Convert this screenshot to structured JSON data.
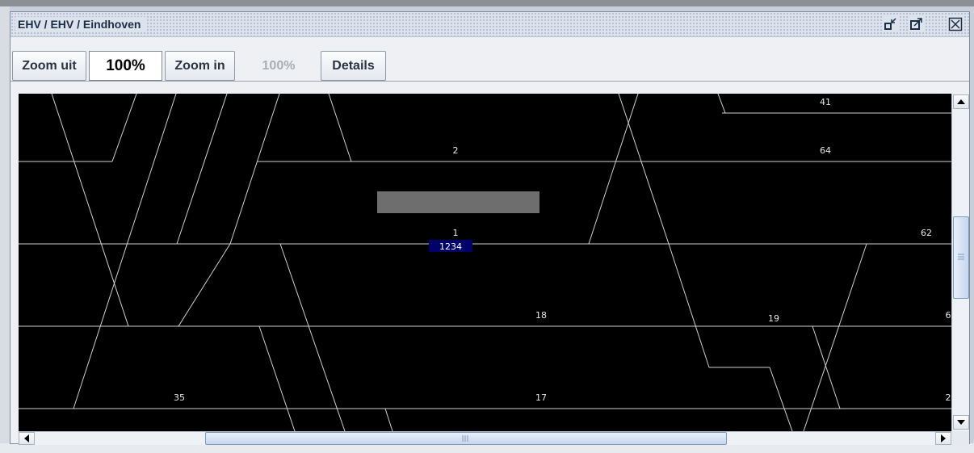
{
  "window": {
    "title": "EHV / EHV / Eindhoven",
    "buttons": {
      "minimize_icon": "iconify-icon",
      "maximize_icon": "maximize-icon",
      "close_icon": "close-icon"
    }
  },
  "toolbar": {
    "zoom_out_label": "Zoom uit",
    "zoom_value": "100%",
    "zoom_in_label": "Zoom in",
    "zoom_disabled_value": "100%",
    "details_label": "Details"
  },
  "diagram": {
    "background": "#000000",
    "line_color": "#cfcfcf",
    "label_color": "#e6e6e6",
    "track_labels": [
      "41",
      "2",
      "64",
      "1",
      "62",
      "18",
      "19",
      "6",
      "35",
      "17",
      "2"
    ],
    "selected_train": {
      "label": "1234",
      "color": "#00006b"
    },
    "occupied_block_color": "#6e6e6e"
  },
  "scrollbars": {
    "vertical": {
      "position": 0.48
    },
    "horizontal": {
      "position": 0.45
    }
  }
}
